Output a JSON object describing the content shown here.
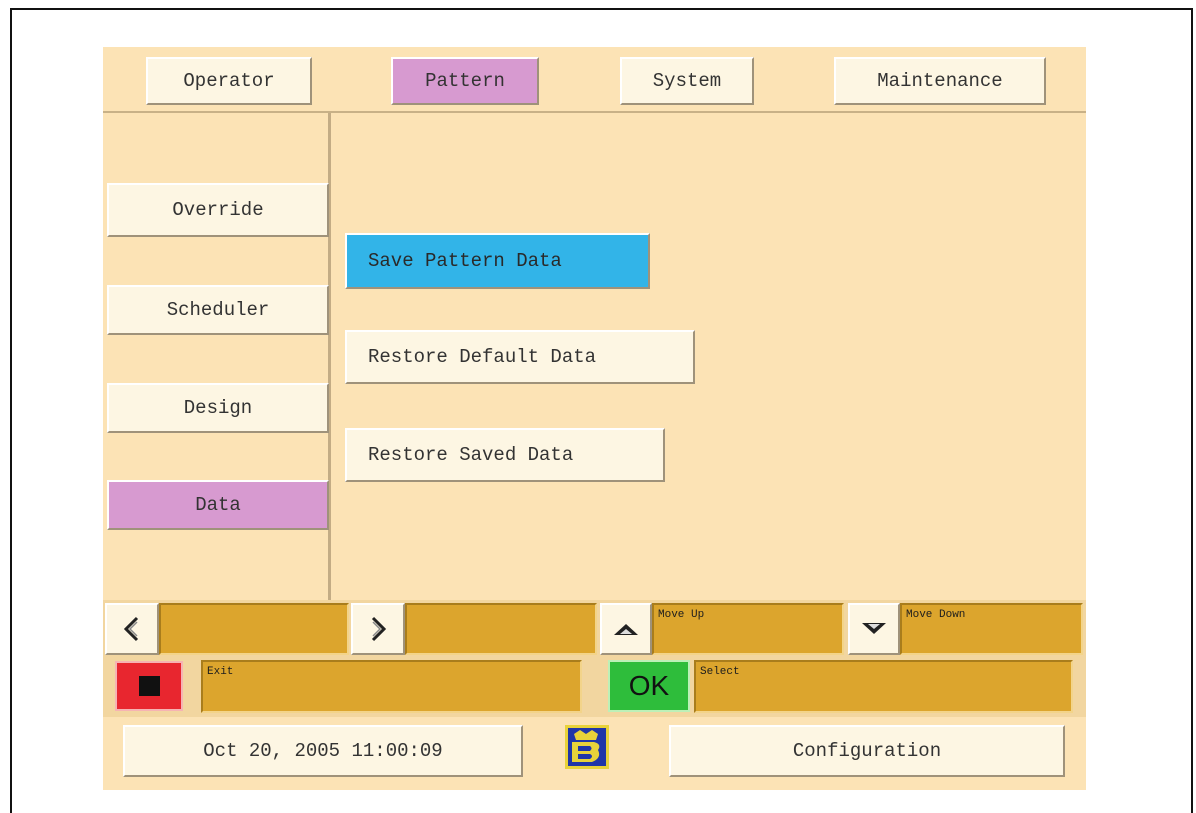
{
  "tabs": {
    "operator": "Operator",
    "pattern": "Pattern",
    "system": "System",
    "maintenance": "Maintenance",
    "active": "pattern"
  },
  "sidebar": {
    "items": [
      {
        "label": "Override"
      },
      {
        "label": "Scheduler"
      },
      {
        "label": "Design"
      },
      {
        "label": "Data"
      }
    ],
    "active": "Data"
  },
  "main": {
    "actions": [
      {
        "label": "Save Pattern Data"
      },
      {
        "label": "Restore Default Data"
      },
      {
        "label": "Restore Saved Data"
      }
    ],
    "selected": "Save Pattern Data"
  },
  "nav": {
    "left_icon": "left-arrow-icon",
    "right_icon": "right-arrow-icon",
    "up_icon": "up-arrow-icon",
    "down_icon": "down-arrow-icon",
    "left_field": "",
    "right_field": "",
    "move_up": "Move Up",
    "move_down": "Move Down"
  },
  "actions_row": {
    "stop_icon": "stop-icon",
    "exit": "Exit",
    "ok": "OK",
    "select": "Select"
  },
  "status": {
    "datetime": "Oct 20, 2005 11:00:09",
    "logo_icon": "brand-logo-icon",
    "configuration": "Configuration"
  },
  "colors": {
    "background": "#fce3b5",
    "active_tab": "#d79ad0",
    "selected_action": "#32b4e8",
    "field": "#dca52d",
    "stop": "#e8262f",
    "ok": "#2ebd3b"
  }
}
